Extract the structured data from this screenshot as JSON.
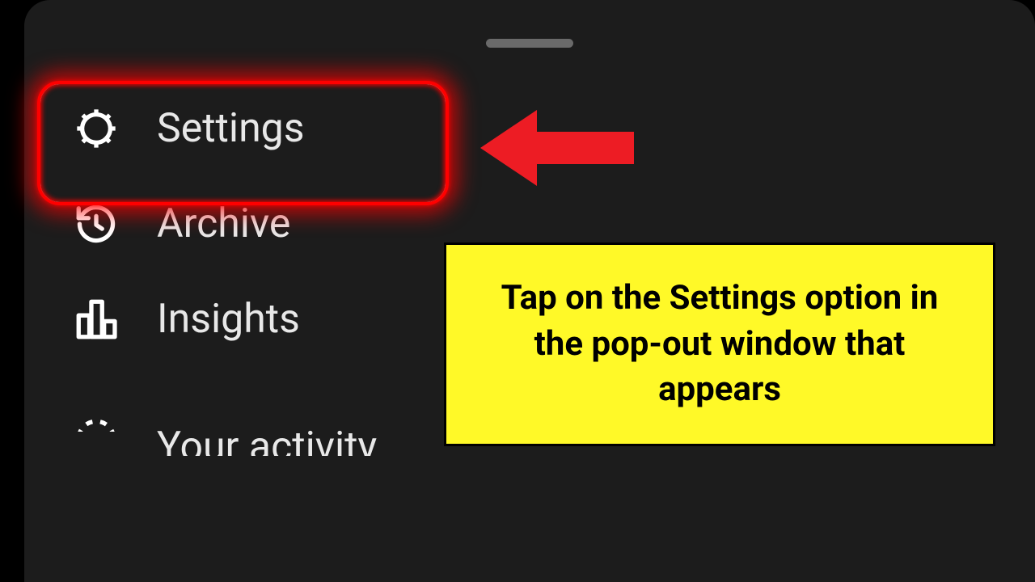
{
  "menu": {
    "items": [
      {
        "label": "Settings"
      },
      {
        "label": "Archive"
      },
      {
        "label": "Insights"
      },
      {
        "label": "Your activity"
      }
    ]
  },
  "annotation": {
    "callout_text": "Tap on the Settings option in the pop-out window that appears"
  }
}
